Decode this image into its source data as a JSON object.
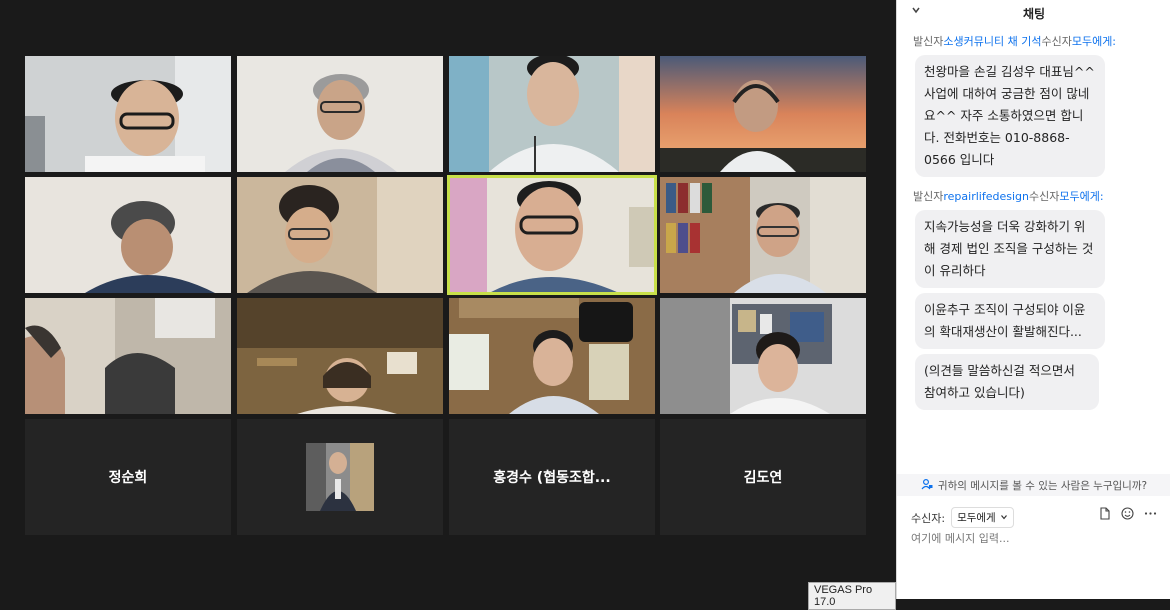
{
  "gallery": {
    "name_tiles": [
      "정순희",
      "홍경수 (협동조합...",
      "김도연"
    ]
  },
  "chat": {
    "title": "채팅",
    "messages": [
      {
        "prefix": "발신자",
        "sender": "소생커뮤니티 채 기석",
        "mid": "수신자",
        "recipient": "모두에게:",
        "bubbles": [
          "천왕마을 손길 김성우 대표님^^ 사업에 대하여 궁금한 점이 많네요^^ 자주 소통하였으면 합니다. 전화번호는 010-8868-0566 입니다"
        ]
      },
      {
        "prefix": "발신자",
        "sender": "repairlifedesign",
        "mid": "수신자",
        "recipient": "모두에게:",
        "bubbles": [
          "지속가능성을 더욱 강화하기 위해 경제 법인 조직을 구성하는 것이 유리하다",
          "이윤추구 조직이 구성되야 이윤의 확대재생산이 활발해진다...",
          "(의견들 말씀하신걸 적으면서 참여하고 있습니다)"
        ]
      }
    ],
    "privacy_notice": "귀하의 메시지를 볼 수 있는 사람은 누구입니까?",
    "recipient_label": "수신자:",
    "recipient_value": "모두에게",
    "input_placeholder": "여기에 메시지 입력..."
  },
  "watermark": "VEGAS Pro 17.0",
  "icons": [
    "chevron-down-icon",
    "person-lock-icon",
    "file-icon",
    "emoji-icon",
    "more-icon"
  ],
  "colors": {
    "accent": "#0e72ed",
    "active_speaker": "#c8e04a"
  }
}
